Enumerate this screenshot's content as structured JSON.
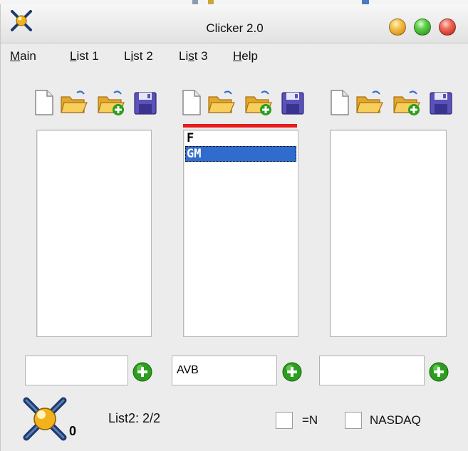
{
  "window": {
    "title": "Clicker 2.0"
  },
  "menubar": {
    "items": [
      {
        "mnemonic": "M",
        "rest": "ain"
      },
      {
        "mnemonic": "L",
        "rest": "ist 1"
      },
      {
        "pre": "L",
        "mnemonic": "i",
        "rest": "st 2"
      },
      {
        "pre": "Li",
        "mnemonic": "s",
        "rest": "t 3"
      },
      {
        "mnemonic": "H",
        "rest": "elp"
      }
    ]
  },
  "lists": [
    {
      "items": [],
      "input": "",
      "active": false
    },
    {
      "items": [
        {
          "text": "F",
          "selected": false
        },
        {
          "text": "GM",
          "selected": true
        }
      ],
      "input": "AVB",
      "active": true
    },
    {
      "items": [],
      "input": "",
      "active": false
    }
  ],
  "toolbar_icons": [
    "new-file-icon",
    "open-folder-icon",
    "add-folder-icon",
    "save-icon"
  ],
  "status": {
    "counter": "0",
    "text": "List2: 2/2"
  },
  "options": [
    {
      "label": "=N",
      "checked": false
    },
    {
      "label": "NASDAQ",
      "checked": false
    }
  ],
  "colors": {
    "active_list_marker": "#ea1b1b",
    "selection": "#2f6ccd",
    "add_button": "#2c9e1e",
    "save_icon": "#5a52b8",
    "folder": "#f3c54a"
  }
}
